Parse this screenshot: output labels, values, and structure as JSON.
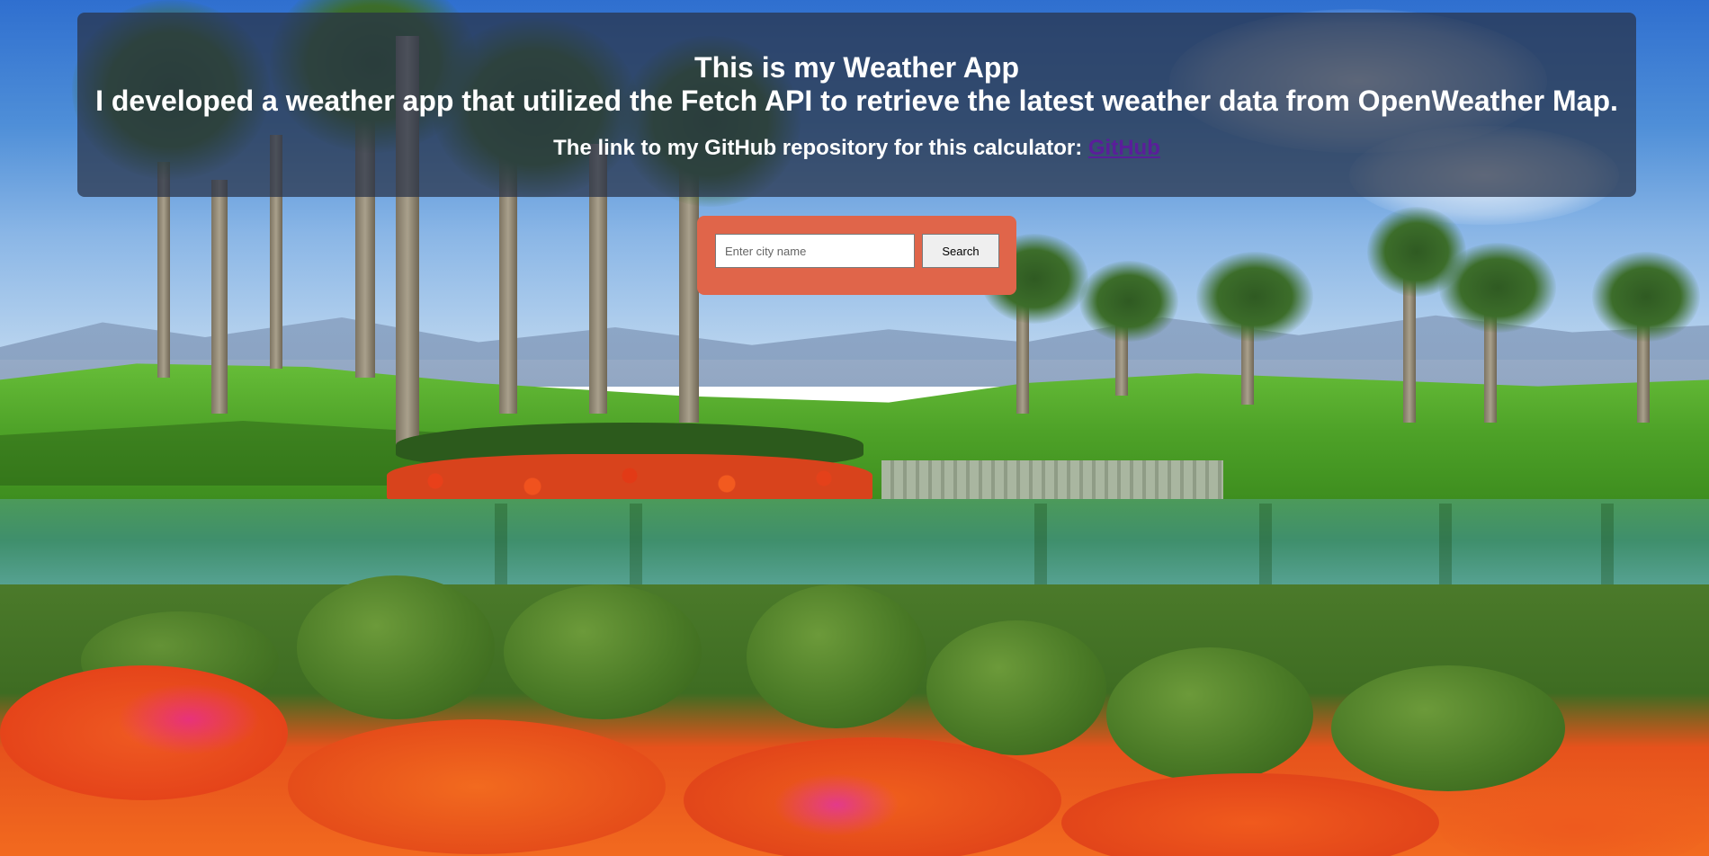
{
  "header": {
    "title": "This is my Weather App",
    "subtitle": "I developed a weather app that utilized the Fetch API to retrieve the latest weather data from OpenWeather Map.",
    "repo_text": "The link to my GitHub repository for this calculator:",
    "repo_link_label": "GitHub"
  },
  "search": {
    "placeholder": "Enter city name",
    "value": "",
    "button_label": "Search"
  },
  "colors": {
    "header_overlay": "#28324699",
    "search_panel": "#e0654a",
    "link": "#5a1e9a",
    "button_bg": "#efefef"
  }
}
